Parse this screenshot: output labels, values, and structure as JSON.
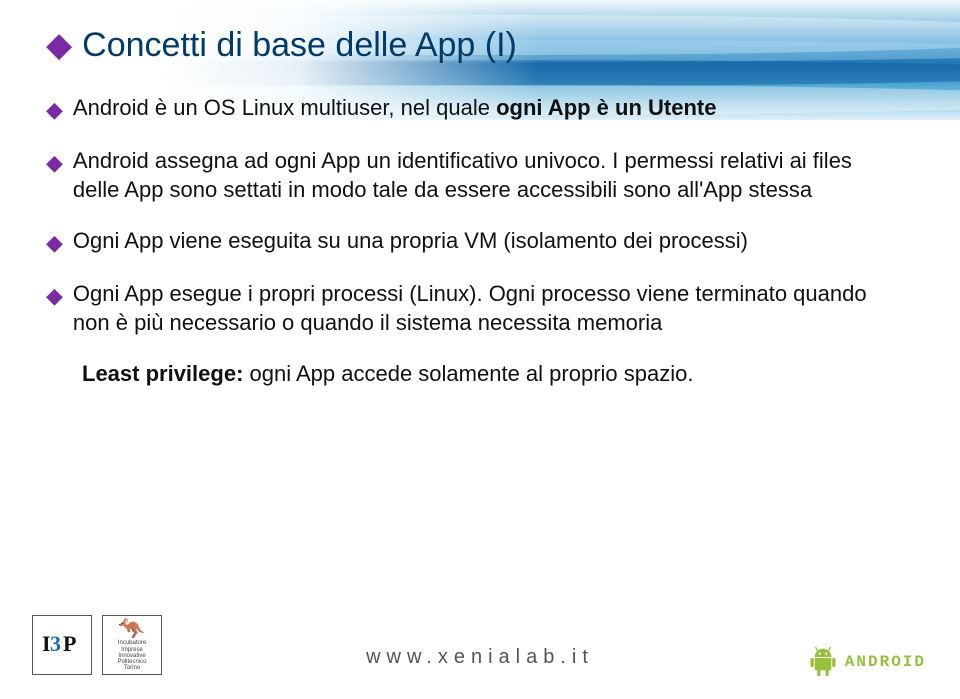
{
  "title": "Concetti di base delle App (I)",
  "bullets": {
    "b1_pre": "Android è un OS Linux multiuser, nel quale ",
    "b1_strong": "ogni App è un Utente",
    "b2": "Android assegna ad ogni App un identificativo univoco. I permessi relativi ai files delle App sono settati in modo tale da essere accessibili sono all'App stessa",
    "b3": "Ogni App viene eseguita su una propria VM (isolamento dei processi)",
    "b4": "Ogni App esegue i propri processi (Linux). Ogni processo viene terminato quando non è più necessario o quando il sistema necessita memoria",
    "b5_strong": "Least privilege:",
    "b5_rest": " ogni App accede solamente al proprio spazio."
  },
  "footer": {
    "incubator_lines": [
      "Incubatore",
      "Imprese",
      "Innovative",
      "Politecnico",
      "Torino"
    ],
    "url": "www.xenialab.it",
    "android": "ANDROID"
  }
}
